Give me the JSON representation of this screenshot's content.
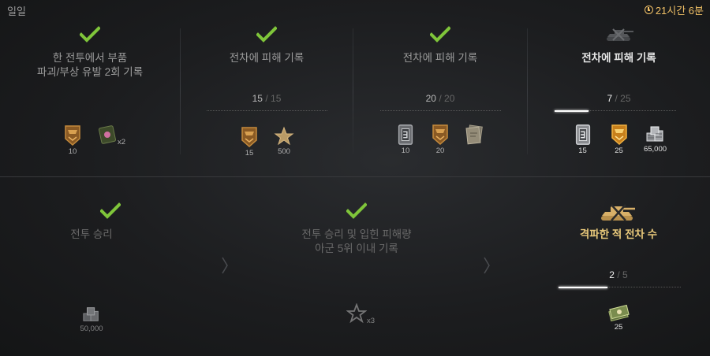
{
  "header": {
    "title": "일일",
    "timer": "21시간 6분"
  },
  "colors": {
    "accent_gold": "#f0c066",
    "check_green": "#7fc53a",
    "text_dim": "#6a6a6a"
  },
  "top_missions": [
    {
      "title_line1": "한 전투에서 부품",
      "title_line2": "파괴/부상 유발 2회 기록",
      "completed": true,
      "rewards": [
        {
          "icon": "bronze-badge-icon",
          "label": "10"
        },
        {
          "icon": "crew-book-icon",
          "label": "",
          "multiplier": "x2"
        }
      ]
    },
    {
      "title_line1": "전차에 피해 기록",
      "completed": true,
      "progress": {
        "current": "15",
        "total": "15",
        "sep": "/"
      },
      "rewards": [
        {
          "icon": "bronze-badge-icon",
          "label": "15"
        },
        {
          "icon": "star-icon",
          "label": "500"
        }
      ]
    },
    {
      "title_line1": "전차에 피해 기록",
      "completed": true,
      "progress": {
        "current": "20",
        "total": "20",
        "sep": "/"
      },
      "rewards": [
        {
          "icon": "silver-badge-icon",
          "label": "10"
        },
        {
          "icon": "bronze-badge-icon",
          "label": "20"
        },
        {
          "icon": "blueprint-icon",
          "label": ""
        }
      ]
    },
    {
      "title_line1": "전차에 피해 기록",
      "completed": false,
      "progress": {
        "current": "7",
        "total": "25",
        "sep": "/",
        "fraction": 0.28
      },
      "rewards": [
        {
          "icon": "silver-badge-icon",
          "label": "15"
        },
        {
          "icon": "gold-badge-icon",
          "label": "25"
        },
        {
          "icon": "credits-icon",
          "label": "65,000"
        }
      ]
    }
  ],
  "bottom_missions": [
    {
      "title_line1": "전투 승리",
      "completed": true,
      "rewards": [
        {
          "icon": "credits-icon",
          "label": "50,000"
        }
      ]
    },
    {
      "title_line1": "전투 승리 및 입힌 피해량",
      "title_line2": "아군 5위 이내 기록",
      "completed": true,
      "rewards": [
        {
          "icon": "star-outline-icon",
          "label": "",
          "multiplier": "x3"
        }
      ]
    },
    {
      "title_line1": "격파한 적 전차 수",
      "completed": false,
      "progress": {
        "current": "2",
        "total": "5",
        "sep": "/",
        "fraction": 0.4
      },
      "rewards": [
        {
          "icon": "bonds-icon",
          "label": "25"
        }
      ]
    }
  ]
}
